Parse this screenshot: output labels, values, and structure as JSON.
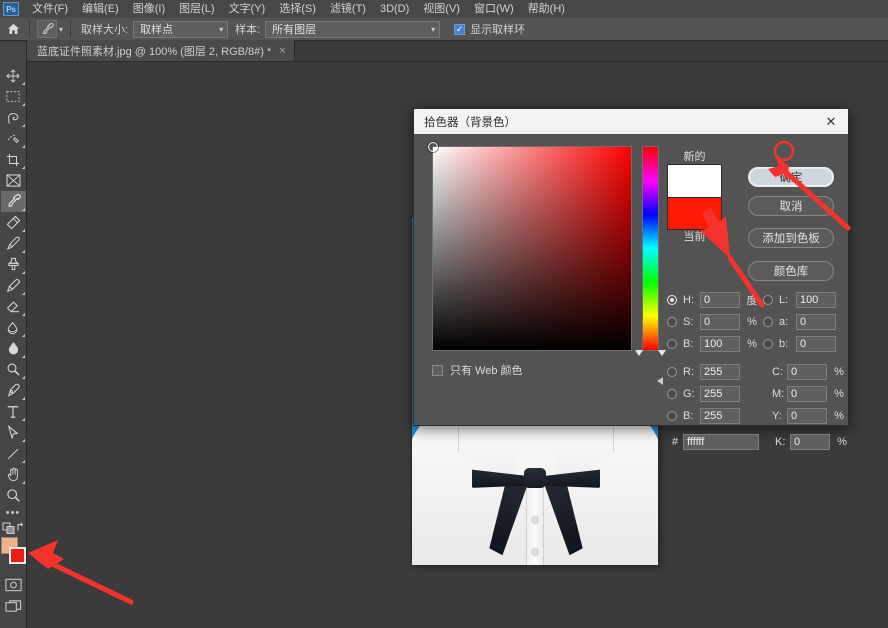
{
  "app": {
    "logo_text": "Ps",
    "menu": [
      {
        "label": "文件(F)",
        "name": "menu-file"
      },
      {
        "label": "编辑(E)",
        "name": "menu-edit"
      },
      {
        "label": "图像(I)",
        "name": "menu-image"
      },
      {
        "label": "图层(L)",
        "name": "menu-layer"
      },
      {
        "label": "文字(Y)",
        "name": "menu-type"
      },
      {
        "label": "选择(S)",
        "name": "menu-select"
      },
      {
        "label": "滤镜(T)",
        "name": "menu-filter"
      },
      {
        "label": "3D(D)",
        "name": "menu-3d"
      },
      {
        "label": "视图(V)",
        "name": "menu-view"
      },
      {
        "label": "窗口(W)",
        "name": "menu-window"
      },
      {
        "label": "帮助(H)",
        "name": "menu-help"
      }
    ]
  },
  "options_bar": {
    "tool_icon": "eyedropper-icon",
    "sample_size_label": "取样大小:",
    "sample_size_value": "取样点",
    "sample_label": "样本:",
    "sample_value": "所有图层",
    "show_ring_label": "显示取样环",
    "show_ring_checked": true,
    "caret": "▾",
    "check_mark": "✓"
  },
  "document_tab": {
    "title": "蓝底证件照素材.jpg @ 100% (图层 2, RGB/8#) *",
    "close": "×"
  },
  "toolbar": {
    "tools": [
      {
        "name": "move-tool",
        "label": "移动工具"
      },
      {
        "name": "marquee-tool",
        "label": "矩形选框工具"
      },
      {
        "name": "lasso-tool",
        "label": "套索工具"
      },
      {
        "name": "quick-selection-tool",
        "label": "快速选择工具"
      },
      {
        "name": "crop-tool",
        "label": "裁剪工具"
      },
      {
        "name": "frame-tool",
        "label": "画框工具"
      },
      {
        "name": "eyedropper-tool",
        "label": "吸管工具",
        "selected": true
      },
      {
        "name": "healing-brush-tool",
        "label": "污点修复画笔工具"
      },
      {
        "name": "brush-tool",
        "label": "画笔工具"
      },
      {
        "name": "clone-stamp-tool",
        "label": "仿制图章工具"
      },
      {
        "name": "history-brush-tool",
        "label": "历史记录画笔工具"
      },
      {
        "name": "eraser-tool",
        "label": "橡皮擦工具"
      },
      {
        "name": "gradient-tool",
        "label": "渐变工具"
      },
      {
        "name": "blur-tool",
        "label": "模糊工具"
      },
      {
        "name": "dodge-tool",
        "label": "减淡工具"
      },
      {
        "name": "pen-tool",
        "label": "钢笔工具"
      },
      {
        "name": "type-tool",
        "label": "横排文字工具"
      },
      {
        "name": "path-selection-tool",
        "label": "路径选择工具"
      },
      {
        "name": "line-tool",
        "label": "直线工具"
      },
      {
        "name": "hand-tool",
        "label": "抓手工具"
      },
      {
        "name": "zoom-tool",
        "label": "缩放工具"
      }
    ],
    "more_tools": "•••",
    "foreground_color": "#f4b183",
    "background_color": "#ef1c15",
    "quick_mask_name": "quick-mask-icon",
    "screen_mode_name": "screen-mode-icon"
  },
  "picker": {
    "title": "拾色器（背景色）",
    "close": "✕",
    "new_label": "新的",
    "current_label": "当前",
    "new_color": "#ffffff",
    "current_color": "#ff1a05",
    "web_only_label": "只有 Web 颜色",
    "web_only_checked": false,
    "buttons": {
      "ok": "确定",
      "cancel": "取消",
      "add_swatch": "添加到色板",
      "color_library": "颜色库"
    },
    "hsb": [
      {
        "key": "H:",
        "value": "0",
        "unit": "度",
        "selected": true
      },
      {
        "key": "S:",
        "value": "0",
        "unit": "%",
        "selected": false
      },
      {
        "key": "B:",
        "value": "100",
        "unit": "%",
        "selected": false
      }
    ],
    "lab": [
      {
        "key": "L:",
        "value": "100",
        "selected": false
      },
      {
        "key": "a:",
        "value": "0",
        "selected": false
      },
      {
        "key": "b:",
        "value": "0",
        "selected": false
      }
    ],
    "rgb": [
      {
        "key": "R:",
        "value": "255",
        "selected": false
      },
      {
        "key": "G:",
        "value": "255",
        "selected": false
      },
      {
        "key": "B:",
        "value": "255",
        "selected": false
      }
    ],
    "cmyk": [
      {
        "key": "C:",
        "value": "0",
        "unit": "%"
      },
      {
        "key": "M:",
        "value": "0",
        "unit": "%"
      },
      {
        "key": "Y:",
        "value": "0",
        "unit": "%"
      },
      {
        "key": "K:",
        "value": "0",
        "unit": "%"
      }
    ],
    "hex_symbol": "#",
    "hex_value": "ffffff"
  },
  "annotations": {
    "arrow_color": "#f5322b",
    "highlight_circle_on": "确定"
  }
}
